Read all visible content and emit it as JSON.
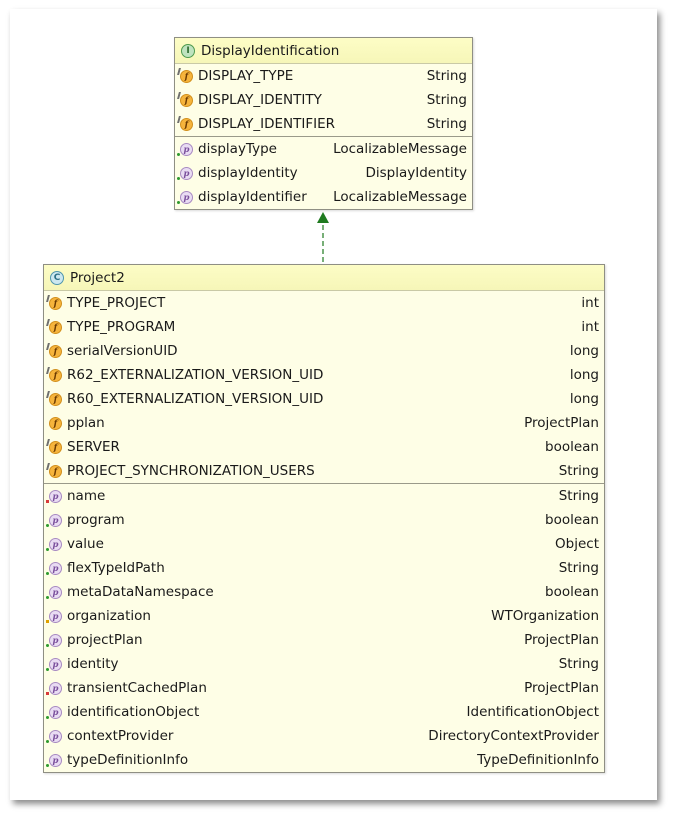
{
  "colors": {
    "box_fill": "#fefee6",
    "header_fill": "#fafac0",
    "field_icon": "#f6b43c",
    "property_icon": "#e9dcf3",
    "arrow": "#1f7a1f"
  },
  "interface_box": {
    "icon": "interface-icon",
    "icon_letter": "I",
    "name": "DisplayIdentification",
    "fields": [
      {
        "icon": "static-final-field-icon",
        "name": "DISPLAY_TYPE",
        "type": "String"
      },
      {
        "icon": "static-final-field-icon",
        "name": "DISPLAY_IDENTITY",
        "type": "String"
      },
      {
        "icon": "static-final-field-icon",
        "name": "DISPLAY_IDENTIFIER",
        "type": "String"
      }
    ],
    "properties": [
      {
        "icon": "property-icon",
        "name": "displayType",
        "type": "LocalizableMessage",
        "vis": "pub"
      },
      {
        "icon": "property-icon",
        "name": "displayIdentity",
        "type": "DisplayIdentity",
        "vis": "pub"
      },
      {
        "icon": "property-icon",
        "name": "displayIdentifier",
        "type": "LocalizableMessage",
        "vis": "pub"
      }
    ]
  },
  "class_box": {
    "icon": "class-icon",
    "icon_letter": "C",
    "name": "Project2",
    "fields": [
      {
        "icon": "static-final-field-icon",
        "name": "TYPE_PROJECT",
        "type": "int",
        "static": true
      },
      {
        "icon": "static-final-field-icon",
        "name": "TYPE_PROGRAM",
        "type": "int",
        "static": true
      },
      {
        "icon": "static-final-field-icon",
        "name": "serialVersionUID",
        "type": "long",
        "static": true
      },
      {
        "icon": "static-final-field-icon",
        "name": "R62_EXTERNALIZATION_VERSION_UID",
        "type": "long",
        "static": true
      },
      {
        "icon": "static-final-field-icon",
        "name": "R60_EXTERNALIZATION_VERSION_UID",
        "type": "long",
        "static": true
      },
      {
        "icon": "field-icon",
        "name": "pplan",
        "type": "ProjectPlan",
        "static": false
      },
      {
        "icon": "static-final-field-icon",
        "name": "SERVER",
        "type": "boolean",
        "static": true
      },
      {
        "icon": "static-final-field-icon",
        "name": "PROJECT_SYNCHRONIZATION_USERS",
        "type": "String",
        "static": true
      }
    ],
    "properties": [
      {
        "icon": "property-icon",
        "name": "name",
        "type": "String",
        "vis": "priv"
      },
      {
        "icon": "property-icon",
        "name": "program",
        "type": "boolean",
        "vis": "pub"
      },
      {
        "icon": "property-icon",
        "name": "value",
        "type": "Object",
        "vis": "pub"
      },
      {
        "icon": "property-icon",
        "name": "flexTypeIdPath",
        "type": "String",
        "vis": "pub"
      },
      {
        "icon": "property-icon",
        "name": "metaDataNamespace",
        "type": "boolean",
        "vis": "pub"
      },
      {
        "icon": "property-icon",
        "name": "organization",
        "type": "WTOrganization",
        "vis": "prot"
      },
      {
        "icon": "property-icon",
        "name": "projectPlan",
        "type": "ProjectPlan",
        "vis": "pub"
      },
      {
        "icon": "property-icon",
        "name": "identity",
        "type": "String",
        "vis": "pub"
      },
      {
        "icon": "property-icon",
        "name": "transientCachedPlan",
        "type": "ProjectPlan",
        "vis": "priv"
      },
      {
        "icon": "property-icon",
        "name": "identificationObject",
        "type": "IdentificationObject",
        "vis": "pub"
      },
      {
        "icon": "property-icon",
        "name": "contextProvider",
        "type": "DirectoryContextProvider",
        "vis": "pub"
      },
      {
        "icon": "property-icon",
        "name": "typeDefinitionInfo",
        "type": "TypeDefinitionInfo",
        "vis": "pub"
      }
    ]
  },
  "relation": {
    "type": "realization",
    "from": "Project2",
    "to": "DisplayIdentification"
  }
}
